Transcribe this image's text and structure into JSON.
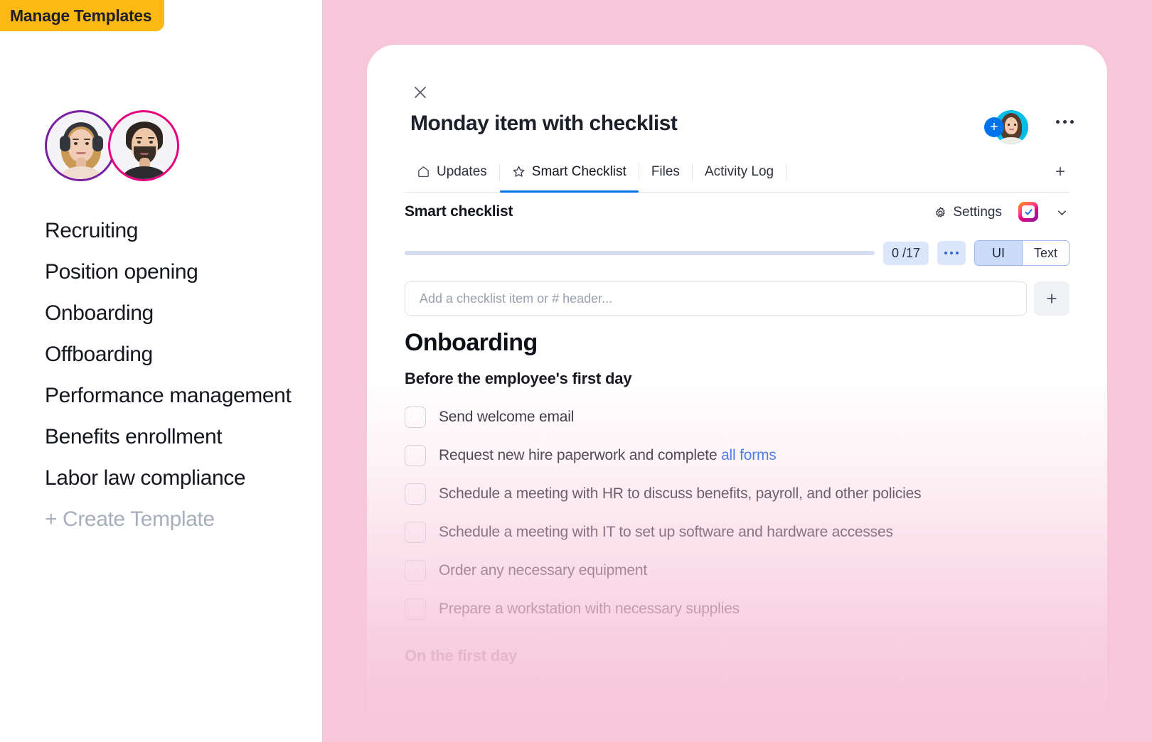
{
  "badge": {
    "label": "Manage Templates",
    "color": "#FCB813"
  },
  "sidebar": {
    "avatars": [
      {
        "name": "teammate-avatar-1",
        "ring_color": "#7B1FA2"
      },
      {
        "name": "teammate-avatar-2",
        "ring_color": "#E6007E"
      }
    ],
    "items": [
      {
        "label": "Recruiting"
      },
      {
        "label": "Position opening"
      },
      {
        "label": "Onboarding"
      },
      {
        "label": "Offboarding"
      },
      {
        "label": "Performance management"
      },
      {
        "label": "Benefits enrollment"
      },
      {
        "label": "Labor law compliance"
      }
    ],
    "create_label": "+ Create Template"
  },
  "panel": {
    "background": "#F7C6D9"
  },
  "card": {
    "close_label": "×",
    "title": "Monday item with checklist",
    "assignee": {
      "add_label": "+"
    },
    "tabs": [
      {
        "label": "Updates",
        "icon": "home-icon",
        "active": false
      },
      {
        "label": "Smart Checklist",
        "icon": "star-icon",
        "active": true
      },
      {
        "label": "Files",
        "icon": "",
        "active": false
      },
      {
        "label": "Activity Log",
        "icon": "",
        "active": false
      }
    ],
    "tab_add_label": "+",
    "section": {
      "title": "Smart checklist",
      "settings_label": "Settings",
      "progress": {
        "count_label": "0 /17",
        "percent": 0
      },
      "view_toggle": {
        "options": [
          "UI",
          "Text"
        ],
        "selected": "UI"
      },
      "add_placeholder": "Add a checklist item or # header...",
      "add_value": "",
      "add_button_label": "+"
    },
    "checklist": {
      "heading": "Onboarding",
      "groups": [
        {
          "title": "Before the employee's first day",
          "muted": false,
          "items": [
            {
              "text": "Send welcome email",
              "link": "",
              "checked": false
            },
            {
              "text": "Request new hire paperwork and complete ",
              "link": "all forms",
              "checked": false
            },
            {
              "text": "Schedule a meeting with HR to discuss benefits, payroll, and other policies",
              "link": "",
              "checked": false
            },
            {
              "text": "Schedule a meeting with IT to set up software and hardware accesses",
              "link": "",
              "checked": false
            },
            {
              "text": "Order any necessary equipment",
              "link": "",
              "checked": false
            },
            {
              "text": "Prepare a workstation with necessary supplies",
              "link": "",
              "checked": false
            }
          ]
        },
        {
          "title": "On the first day",
          "muted": true,
          "items": []
        }
      ]
    }
  },
  "colors": {
    "accent_blue": "#0073EA",
    "link_blue": "#2a6ff0",
    "chip_blue": "#DCE6FB",
    "pink": "#F7C6D9",
    "badge_yellow": "#FCB813"
  }
}
